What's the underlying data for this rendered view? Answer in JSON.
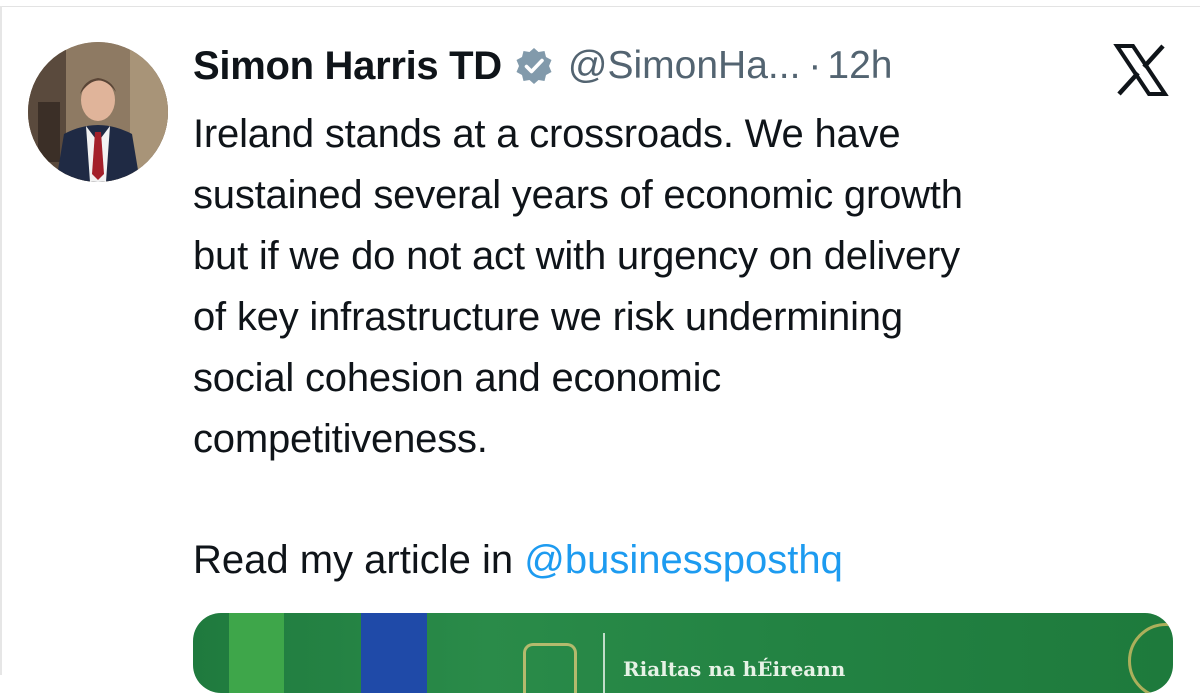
{
  "author": {
    "name": "Simon Harris TD",
    "handle": "@SimonHa...",
    "separator": "·",
    "time": "12h",
    "verified_icon": "verified-badge-icon"
  },
  "tweet": {
    "lines": [
      "Ireland stands at a crossroads. We have",
      "sustained several years of economic growth",
      "but if we do not act with urgency on delivery",
      "of key infrastructure we risk undermining",
      "social cohesion and economic",
      "competitiveness."
    ],
    "read_prefix": "Read my article in ",
    "mention": "@businessposthq"
  },
  "card": {
    "text": "Rialtas na hÉireann"
  },
  "colors": {
    "link": "#1d9bf0",
    "muted": "#536471",
    "text": "#0f1419",
    "verified": "#829aab"
  },
  "icons": {
    "platform": "x-logo-icon"
  }
}
